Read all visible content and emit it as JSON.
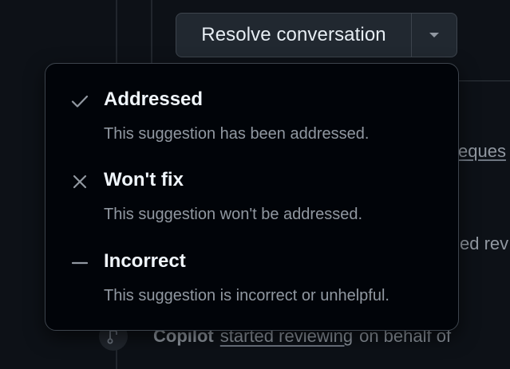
{
  "resolve_button": {
    "label": "Resolve conversation",
    "caret_icon": "triangle-down-icon"
  },
  "background": {
    "partial_link_text": "eques",
    "partial_text": "ed rev",
    "timeline_event": {
      "actor": "Copilot",
      "link": "started reviewing",
      "rest": "on behalf of",
      "icon": "git-pull-request-icon"
    }
  },
  "menu": {
    "items": [
      {
        "title": "Addressed",
        "description": "This suggestion has been addressed.",
        "icon": "check-icon"
      },
      {
        "title": "Won't fix",
        "description": "This suggestion won't be addressed.",
        "icon": "x-icon"
      },
      {
        "title": "Incorrect",
        "description": "This suggestion is incorrect or unhelpful.",
        "icon": "dash-icon"
      }
    ]
  },
  "colors": {
    "background": "#0d1117",
    "menu_background": "#010409",
    "border": "#3d444d",
    "title_text": "#f0f6fc",
    "muted_text": "#9198a1"
  }
}
